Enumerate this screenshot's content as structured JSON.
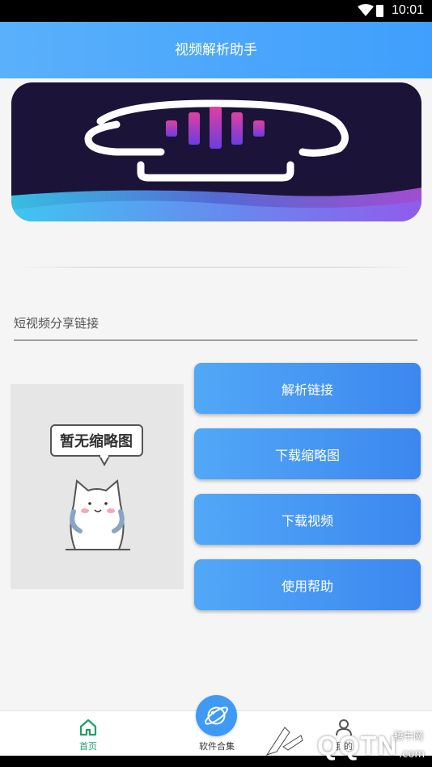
{
  "status_bar": {
    "time": "10:01"
  },
  "app_bar": {
    "title": "视频解析助手"
  },
  "link_input": {
    "placeholder": "短视频分享链接"
  },
  "thumbnail": {
    "caption": "暂无缩略图"
  },
  "actions": {
    "parse_label": "解析链接",
    "download_thumbnail_label": "下载缩略图",
    "download_video_label": "下载视频",
    "help_label": "使用帮助"
  },
  "tabbar": {
    "home_label": "首页",
    "apps_label": "软件合集",
    "mine_label": "我的"
  },
  "watermark": {
    "brand": "QQTN",
    "suffix": ".com",
    "site_name": "腾牛网"
  },
  "colors": {
    "accent": "#3f9ffc",
    "tab_active": "#1e9e68",
    "banner_bg": "#1c1338"
  }
}
